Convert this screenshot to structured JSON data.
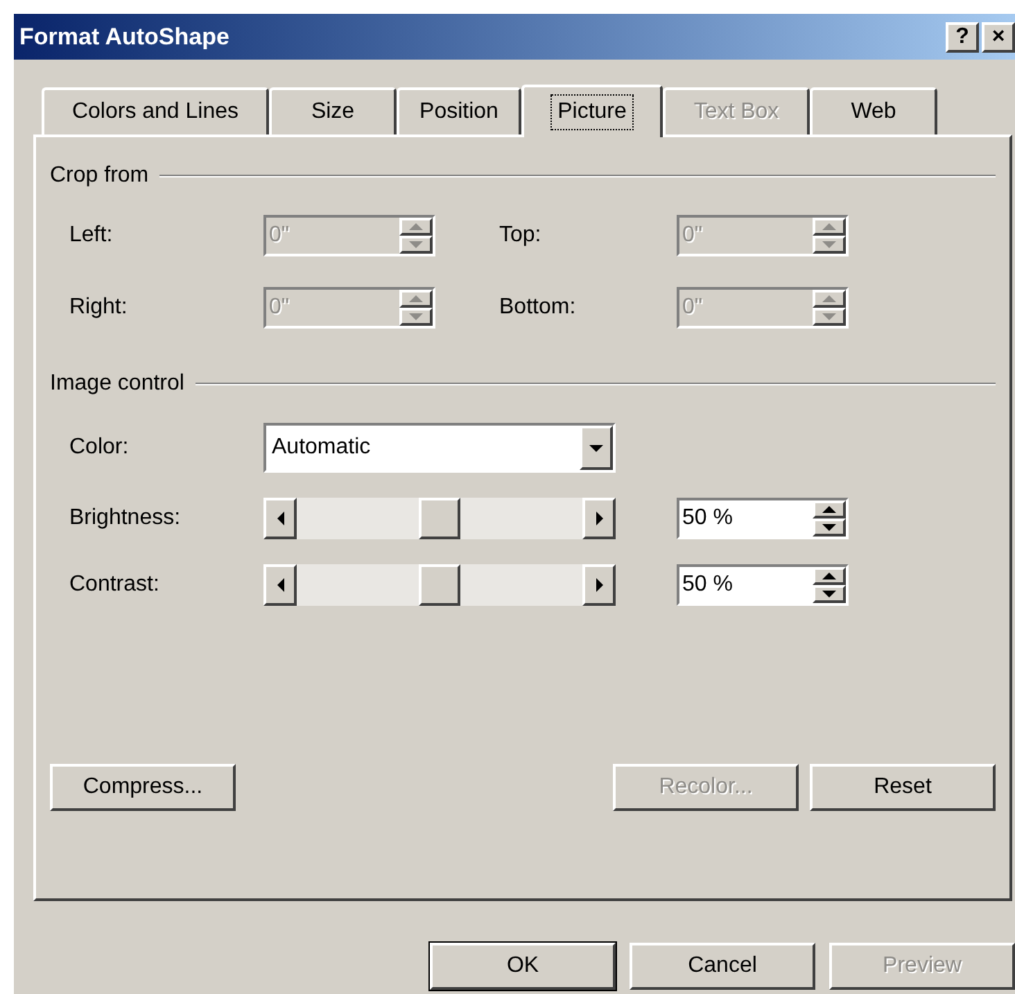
{
  "window": {
    "title": "Format AutoShape",
    "buttons": [
      "?",
      "×"
    ]
  },
  "tabs": [
    {
      "label": "Colors and Lines",
      "selected": false,
      "disabled": false
    },
    {
      "label": "Size",
      "selected": false,
      "disabled": false
    },
    {
      "label": "Position",
      "selected": false,
      "disabled": false
    },
    {
      "label": "Picture",
      "selected": true,
      "disabled": false
    },
    {
      "label": "Text Box",
      "selected": false,
      "disabled": true
    },
    {
      "label": "Web",
      "selected": false,
      "disabled": false
    }
  ],
  "crop_from": {
    "title": "Crop from",
    "fields": [
      {
        "label": "Left:",
        "value": "0\"",
        "disabled": true
      },
      {
        "label": "Top:",
        "value": "0\"",
        "disabled": true
      },
      {
        "label": "Right:",
        "value": "0\"",
        "disabled": true
      },
      {
        "label": "Bottom:",
        "value": "0\"",
        "disabled": true
      }
    ]
  },
  "image_control": {
    "title": "Image control",
    "color": {
      "label": "Color:",
      "value": "Automatic"
    },
    "sliders": [
      {
        "label": "Brightness:",
        "level": 0.5,
        "value": "50 %"
      },
      {
        "label": "Contrast:",
        "level": 0.5,
        "value": "50 %"
      }
    ]
  },
  "panel_buttons": [
    {
      "label": "Compress...",
      "disabled": false
    },
    {
      "label": "Recolor...",
      "disabled": true
    },
    {
      "label": "Reset",
      "disabled": false
    }
  ],
  "buttons": [
    {
      "label": "OK",
      "default": true,
      "disabled": false
    },
    {
      "label": "Cancel",
      "default": false,
      "disabled": false
    },
    {
      "label": "Preview",
      "default": false,
      "disabled": true
    }
  ]
}
